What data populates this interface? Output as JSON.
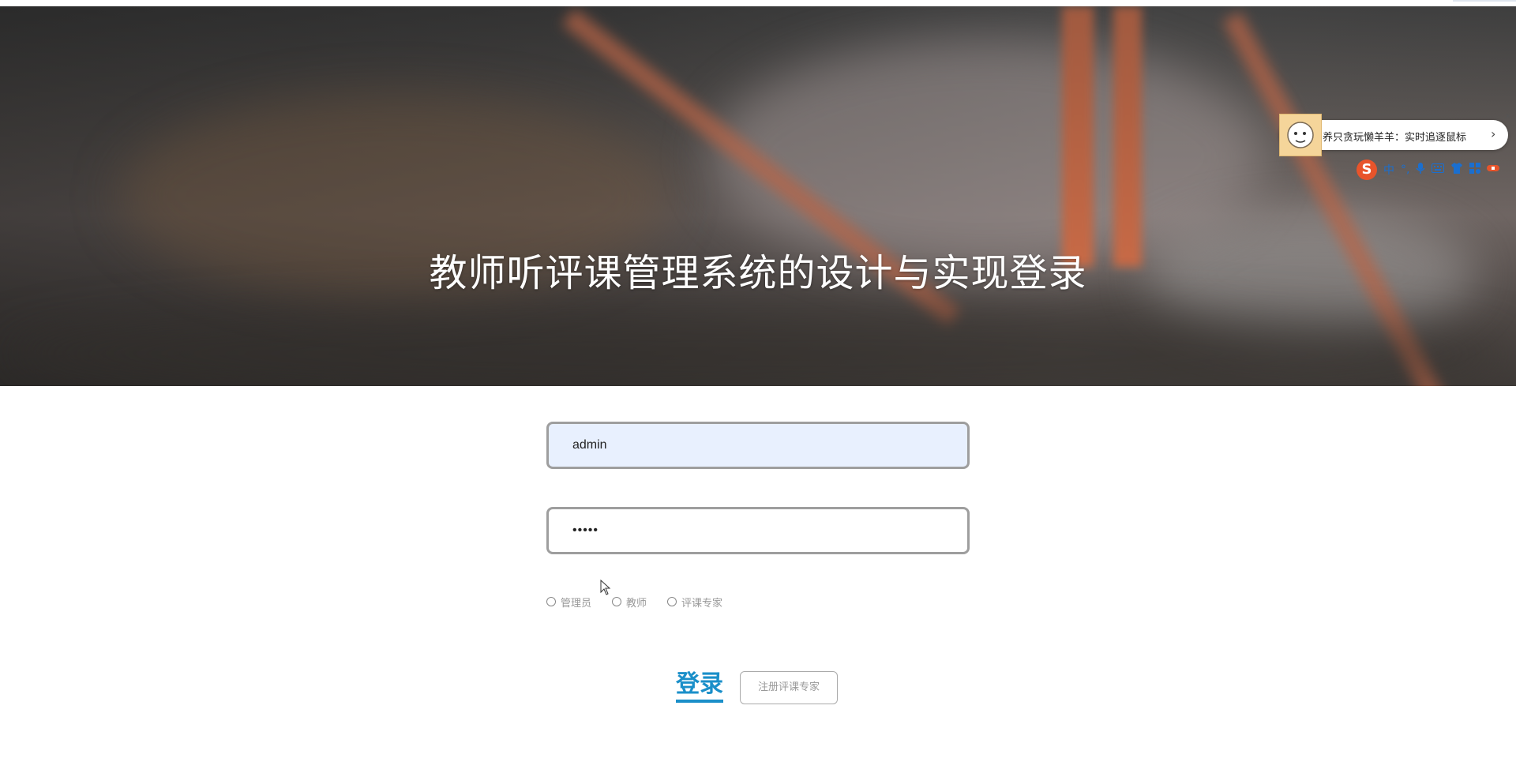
{
  "page": {
    "title": "教师听评课管理系统的设计与实现登录"
  },
  "form": {
    "username_value": "admin",
    "password_value": "•••••",
    "roles": [
      {
        "label": "管理员"
      },
      {
        "label": "教师"
      },
      {
        "label": "评课专家"
      }
    ],
    "login_label": "登录",
    "register_label": "注册评课专家"
  },
  "ad_widget": {
    "text": "养只贪玩懒羊羊：实时追逐鼠标",
    "arrow": "›",
    "close": "×"
  },
  "ime_toolbar": {
    "logo": "S",
    "mode": "中",
    "punct": "°,"
  },
  "colors": {
    "accent": "#1a8fc9",
    "input_fill": "#e8f0fe",
    "border": "#9e9e9e"
  }
}
